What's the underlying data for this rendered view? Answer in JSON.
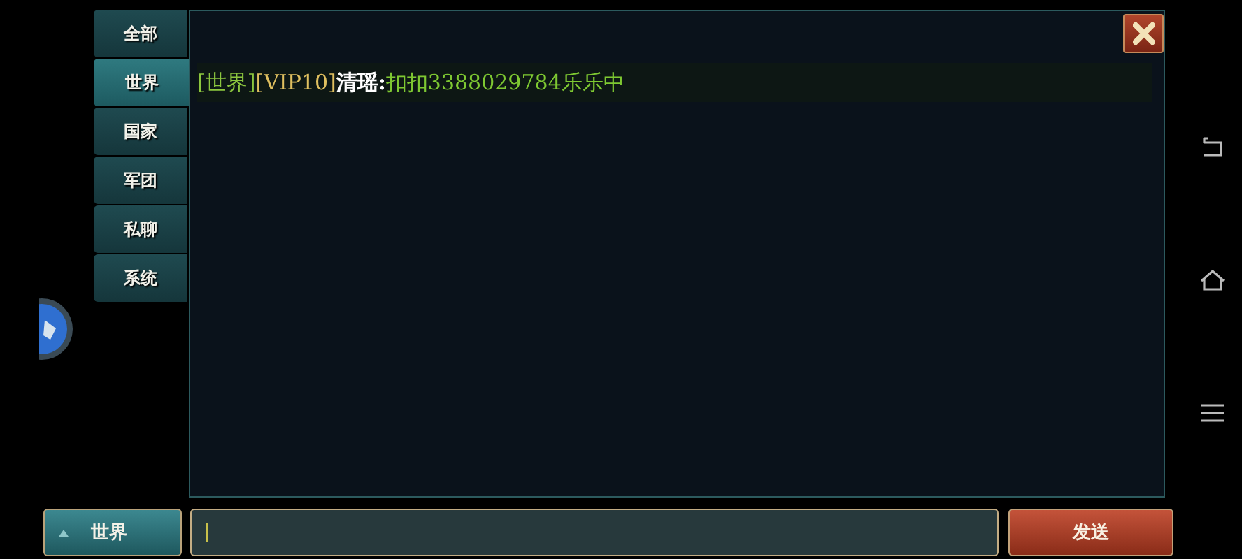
{
  "tabs": [
    {
      "label": "全部",
      "selected": false
    },
    {
      "label": "世界",
      "selected": true
    },
    {
      "label": "国家",
      "selected": false
    },
    {
      "label": "军团",
      "selected": false
    },
    {
      "label": "私聊",
      "selected": false
    },
    {
      "label": "系统",
      "selected": false
    }
  ],
  "messages": [
    {
      "parts": [
        {
          "kind": "channel",
          "text": "[世界]"
        },
        {
          "kind": "vip",
          "text": "[VIP10]"
        },
        {
          "kind": "sender",
          "text": "清瑶:"
        },
        {
          "kind": "content",
          "text": "扣扣3388029784乐乐中"
        }
      ]
    }
  ],
  "channel_button": {
    "label": "世界"
  },
  "send_button": {
    "label": "发送"
  }
}
